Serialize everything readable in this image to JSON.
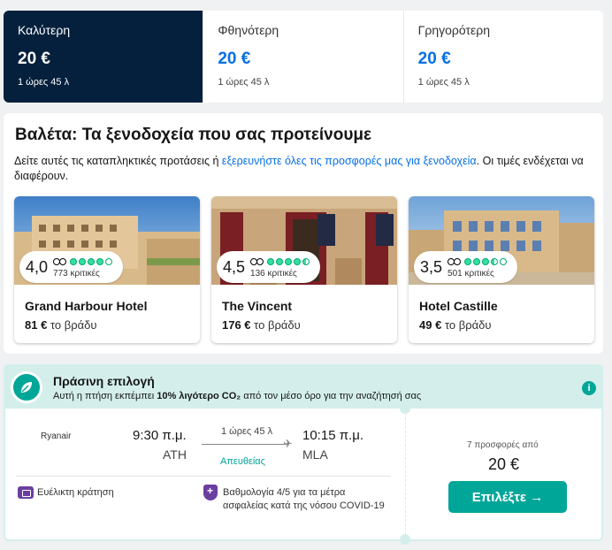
{
  "sort_tabs": [
    {
      "label": "Καλύτερη",
      "price": "20 €",
      "duration": "1 ώρες 45 λ",
      "active": true
    },
    {
      "label": "Φθηνότερη",
      "price": "20 €",
      "duration": "1 ώρες 45 λ",
      "active": false
    },
    {
      "label": "Γρηγορότερη",
      "price": "20 €",
      "duration": "1 ώρες 45 λ",
      "active": false
    }
  ],
  "hotels": {
    "title": "Βαλέτα: Τα ξενοδοχεία που σας προτείνουμε",
    "desc_before": "Δείτε αυτές τις καταπληκτικές προτάσεις ή ",
    "desc_link": "εξερευνήστε όλες τις προσφορές μας για ξενοδοχεία",
    "desc_after": ". Οι τιμές ενδέχεται να διαφέρουν.",
    "cards": [
      {
        "name": "Grand Harbour Hotel",
        "rating": "4,0",
        "reviews": "773 κριτικές",
        "price": "81 €",
        "per": "το βράδυ"
      },
      {
        "name": "The Vincent",
        "rating": "4,5",
        "reviews": "136 κριτικές",
        "price": "176 €",
        "per": "το βράδυ"
      },
      {
        "name": "Hotel Castille",
        "rating": "3,5",
        "reviews": "501 κριτικές",
        "price": "49 €",
        "per": "το βράδυ"
      }
    ]
  },
  "green": {
    "title": "Πράσινη επιλογή",
    "desc_before": "Αυτή η πτήση εκπέμπει ",
    "desc_bold": "10% λιγότερο CO₂",
    "desc_after": " από τον μέσο όρο για την αναζήτησή σας",
    "info_icon": "i"
  },
  "flight": {
    "airline": "Ryanair",
    "dep_time": "9:30 π.μ.",
    "dep_code": "ATH",
    "duration": "1 ώρες 45 λ",
    "stops": "Απευθείας",
    "arr_time": "10:15 π.μ.",
    "arr_code": "MLA",
    "flexible": "Ευέλικτη κράτηση",
    "covid": "Βαθμολογία 4/5 για τα μέτρα ασφαλείας κατά της νόσου COVID-19",
    "offers": "7 προσφορές από",
    "price": "20 €",
    "select": "Επιλέξτε →"
  }
}
